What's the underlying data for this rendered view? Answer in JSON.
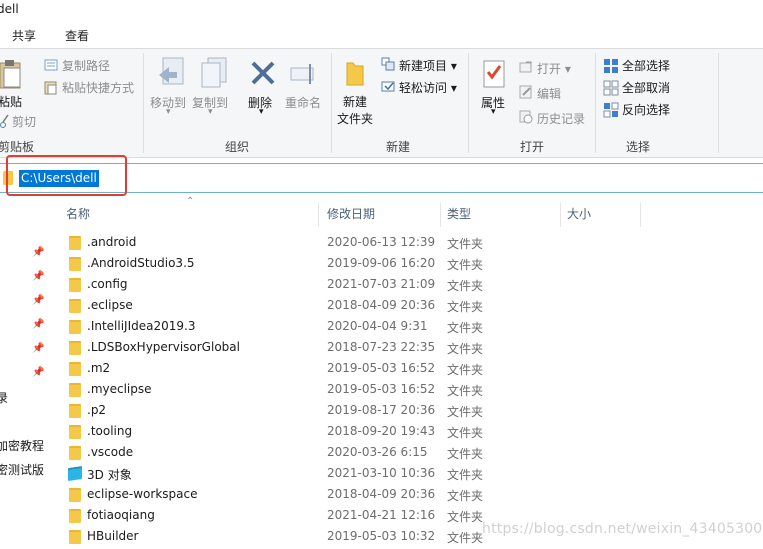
{
  "window": {
    "title": "dell"
  },
  "ribbon_tabs": [
    "共享",
    "查看"
  ],
  "ribbon": {
    "clipboard": {
      "paste": "粘贴",
      "copy_path": "复制路径",
      "paste_shortcut": "粘贴快捷方式",
      "cut": "剪切",
      "group_label": "剪贴板"
    },
    "organize": {
      "move_to": "移动到",
      "copy_to": "复制到",
      "delete": "删除",
      "rename": "重命名",
      "group_label": "组织"
    },
    "new": {
      "new_folder_line1": "新建",
      "new_folder_line2": "文件夹",
      "new_item": "新建项目 ▾",
      "easy_access": "轻松访问 ▾",
      "group_label": "新建"
    },
    "open": {
      "properties": "属性",
      "open": "打开 ▾",
      "edit": "编辑",
      "history": "历史记录",
      "group_label": "打开"
    },
    "select": {
      "select_all": "全部选择",
      "select_none": "全部取消",
      "invert": "反向选择",
      "group_label": "选择"
    }
  },
  "address_bar": {
    "path": "C:\\Users\\dell"
  },
  "columns": {
    "name": "名称",
    "modified": "修改日期",
    "type": "类型",
    "size": "大小"
  },
  "nav_pane": {
    "items": [
      "录",
      "加密教程",
      "密测试版"
    ]
  },
  "files": [
    {
      "name": ".android",
      "date": "2020-06-13 12:39",
      "type": "文件夹"
    },
    {
      "name": ".AndroidStudio3.5",
      "date": "2019-09-06 16:20",
      "type": "文件夹"
    },
    {
      "name": ".config",
      "date": "2021-07-03 21:09",
      "type": "文件夹"
    },
    {
      "name": ".eclipse",
      "date": "2018-04-09 20:36",
      "type": "文件夹"
    },
    {
      "name": ".IntelliJIdea2019.3",
      "date": "2020-04-04 9:31",
      "type": "文件夹"
    },
    {
      "name": ".LDSBoxHypervisorGlobal",
      "date": "2018-07-23 22:35",
      "type": "文件夹"
    },
    {
      "name": ".m2",
      "date": "2019-05-03 16:52",
      "type": "文件夹"
    },
    {
      "name": ".myeclipse",
      "date": "2019-05-03 16:52",
      "type": "文件夹"
    },
    {
      "name": ".p2",
      "date": "2019-08-17 20:36",
      "type": "文件夹"
    },
    {
      "name": ".tooling",
      "date": "2018-09-20 19:43",
      "type": "文件夹"
    },
    {
      "name": ".vscode",
      "date": "2020-03-26 6:15",
      "type": "文件夹"
    },
    {
      "name": "3D 对象",
      "date": "2021-03-10 10:36",
      "type": "文件夹"
    },
    {
      "name": "eclipse-workspace",
      "date": "2018-04-09 20:36",
      "type": "文件夹"
    },
    {
      "name": "fotiaoqiang",
      "date": "2021-04-21 12:16",
      "type": "文件夹"
    },
    {
      "name": "HBuilder",
      "date": "2019-05-03 10:32",
      "type": "文件夹"
    }
  ],
  "watermark": "https://blog.csdn.net/weixin_43405300"
}
